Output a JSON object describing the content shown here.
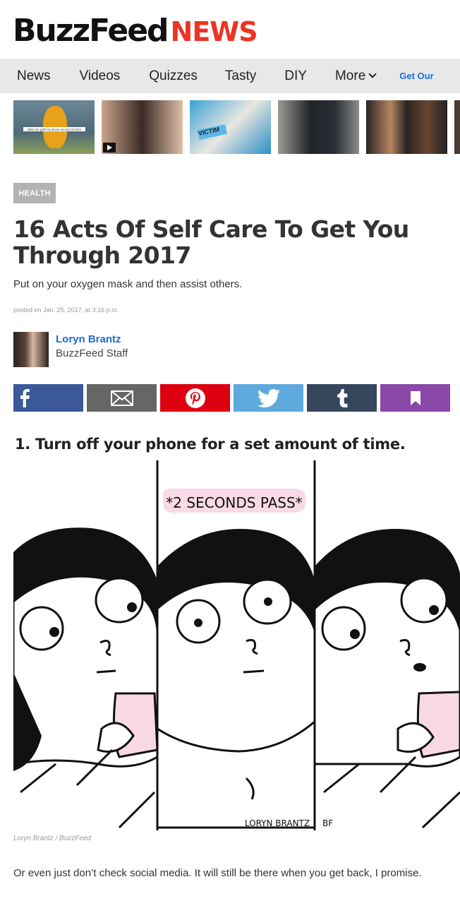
{
  "brand": {
    "logo_main": "BuzzFeed",
    "logo_sub": "NEWS",
    "accent": "#ee3322"
  },
  "nav": {
    "items": [
      "News",
      "Videos",
      "Quizzes",
      "Tasty",
      "DIY",
      "More"
    ],
    "cta": "Get Our"
  },
  "thumbnails": [
    {
      "name": "winnie-the-pooh-thumb",
      "caption": "When he pulls his phone out and it's then"
    },
    {
      "name": "selfie-video-thumb",
      "has_play_icon": true
    },
    {
      "name": "victim-stickers-thumb",
      "text": "VICTIM"
    },
    {
      "name": "funeral-people-thumb"
    },
    {
      "name": "actors-thumb"
    }
  ],
  "article": {
    "section_tag": "HEALTH",
    "title": "16 Acts Of Self Care To Get You Through 2017",
    "subtitle": "Put on your oxygen mask and then assist others.",
    "posted": "posted on Jan. 25, 2017, at 3:16 p.m.",
    "author": {
      "name": "Loryn Brantz",
      "role": "BuzzFeed Staff"
    },
    "share": [
      "facebook-icon",
      "email-icon",
      "pinterest-icon",
      "twitter-icon",
      "tumblr-icon",
      "bookmark-icon"
    ],
    "items": [
      {
        "heading": "1. Turn off your phone for a set amount of time.",
        "comic_caption": "*2 SECONDS PASS*",
        "comic_signature": "LORYN BRANTZ",
        "comic_signature_mark": "BF",
        "credit": "Loryn Brantz / BuzzFeed",
        "body": "Or even just don’t check social media. It will still be there when you get back, I promise."
      }
    ]
  },
  "colors": {
    "facebook": "#3b5998",
    "email": "#666666",
    "pinterest": "#dd0011",
    "twitter": "#5ea9dd",
    "tumblr": "#36465d",
    "bookmark": "#8a48a8",
    "link": "#1a6fd4",
    "tag_bg": "#b3b3b3",
    "nav_bg": "#e8e8e8"
  }
}
